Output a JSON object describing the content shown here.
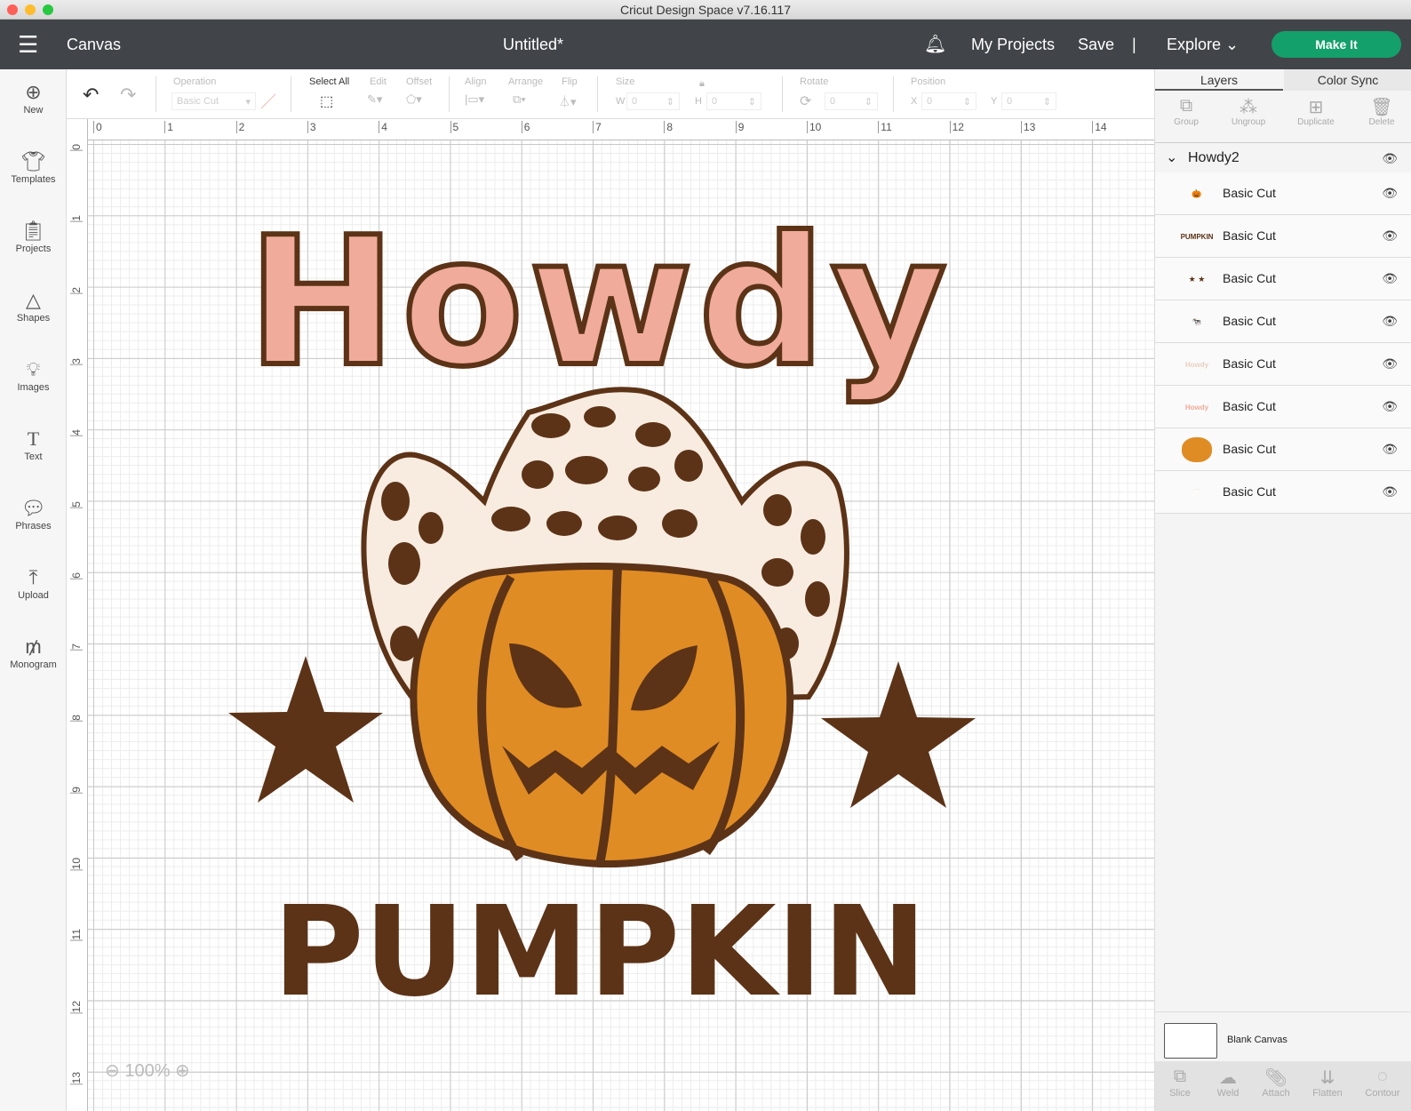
{
  "window": {
    "title": "Cricut Design Space  v7.16.117"
  },
  "header": {
    "menu_icon": "hamburger-icon",
    "section": "Canvas",
    "doc_title": "Untitled*",
    "bell_icon": "bell-icon",
    "my_projects": "My Projects",
    "save": "Save",
    "separator": "|",
    "explore": "Explore",
    "make_it": "Make It",
    "make_it_color": "#14a06a"
  },
  "sidebar": {
    "items": [
      {
        "label": "New",
        "icon": "plus-circle-icon"
      },
      {
        "label": "Templates",
        "icon": "shirt-icon"
      },
      {
        "label": "Projects",
        "icon": "clipboard-icon"
      },
      {
        "label": "Shapes",
        "icon": "shapes-icon"
      },
      {
        "label": "Images",
        "icon": "lightbulb-icon"
      },
      {
        "label": "Text",
        "icon": "text-icon"
      },
      {
        "label": "Phrases",
        "icon": "speech-bubble-icon"
      },
      {
        "label": "Upload",
        "icon": "upload-icon"
      },
      {
        "label": "Monogram",
        "icon": "monogram-icon"
      }
    ]
  },
  "toolbar": {
    "operation_label": "Operation",
    "operation_value": "Basic Cut",
    "select_all": "Select All",
    "edit": "Edit",
    "offset": "Offset",
    "align": "Align",
    "arrange": "Arrange",
    "flip": "Flip",
    "size": "Size",
    "w_label": "W",
    "w_value": "0",
    "h_label": "H",
    "h_value": "0",
    "rotate": "Rotate",
    "rotate_value": "0",
    "position": "Position",
    "x_label": "X",
    "x_value": "0",
    "y_label": "Y",
    "y_value": "0"
  },
  "canvas": {
    "h_ruler": [
      "0",
      "1",
      "2",
      "3",
      "4",
      "5",
      "6",
      "7",
      "8",
      "9",
      "10",
      "11",
      "12",
      "13",
      "14"
    ],
    "v_ruler": [
      "0",
      "1",
      "2",
      "3",
      "4",
      "5",
      "6",
      "7",
      "8",
      "9",
      "10",
      "11",
      "12",
      "13"
    ],
    "zoom": "100%",
    "art": {
      "top_text": "Howdy",
      "bottom_text": "PUMPKIN",
      "colors": {
        "pink": "#f0ab9a",
        "brown": "#5c3317",
        "orange": "#e08c24",
        "cream": "#f8ebe0"
      }
    }
  },
  "panel": {
    "tabs": [
      "Layers",
      "Color Sync"
    ],
    "tools": [
      "Group",
      "Ungroup",
      "Duplicate",
      "Delete"
    ],
    "group_name": "Howdy2",
    "layers": [
      {
        "name": "Basic Cut",
        "thumb": "pumpkin-hat-thumbnail"
      },
      {
        "name": "Basic Cut",
        "thumb": "pumpkin-text-thumbnail",
        "thumb_text": "PUMPKIN"
      },
      {
        "name": "Basic Cut",
        "thumb": "stars-thumbnail"
      },
      {
        "name": "Basic Cut",
        "thumb": "cow-print-thumbnail"
      },
      {
        "name": "Basic Cut",
        "thumb": "howdy-outline-thumbnail",
        "thumb_text": "Howdy"
      },
      {
        "name": "Basic Cut",
        "thumb": "howdy-pink-thumbnail",
        "thumb_text": "Howdy"
      },
      {
        "name": "Basic Cut",
        "thumb": "orange-pumpkin-thumbnail"
      },
      {
        "name": "Basic Cut",
        "thumb": "cream-hat-thumbnail"
      }
    ],
    "blank_canvas": "Blank Canvas",
    "bottom_tools": [
      "Slice",
      "Weld",
      "Attach",
      "Flatten",
      "Contour"
    ]
  }
}
